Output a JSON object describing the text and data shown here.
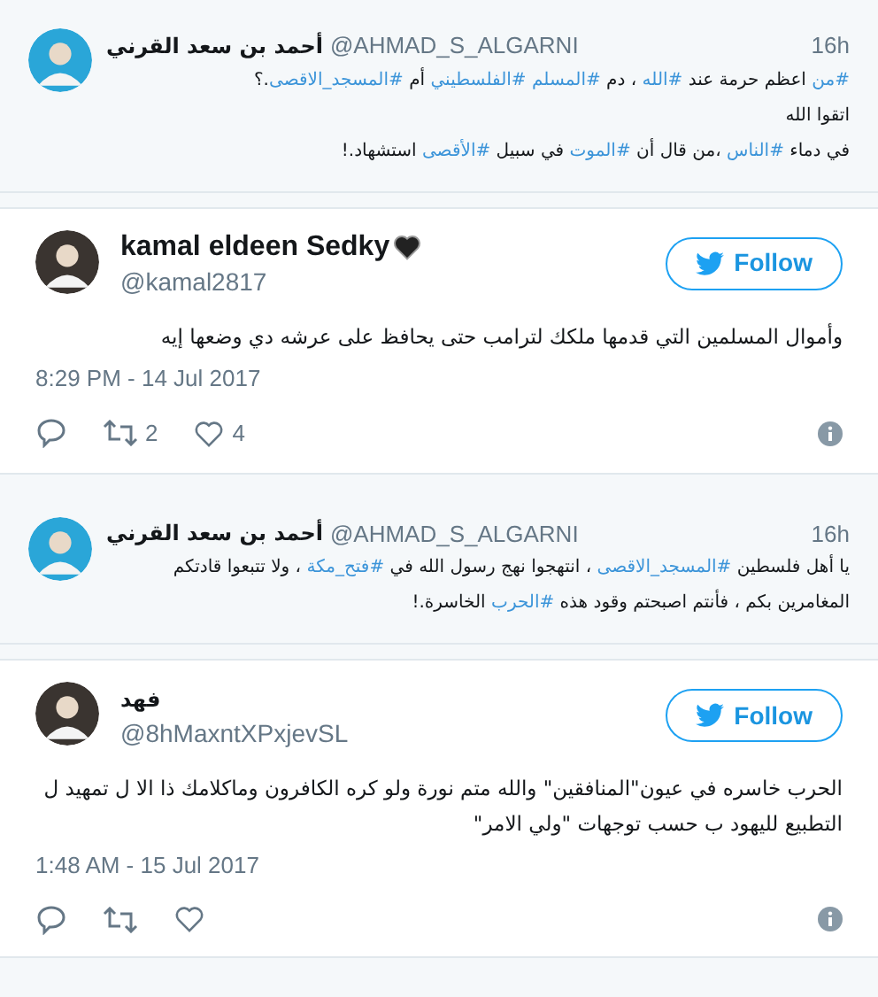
{
  "items": [
    {
      "kind": "quote",
      "name": "أحمد بن سعد القرني",
      "handle": "@AHMAD_S_ALGARNI",
      "time": "16h",
      "lines": [
        [
          {
            "text": "#من",
            "hashtag": true
          },
          {
            "text": " اعظم حرمة عند ",
            "hashtag": false
          },
          {
            "text": "#الله",
            "hashtag": true
          },
          {
            "text": " ، دم ",
            "hashtag": false
          },
          {
            "text": "#المسلم ",
            "hashtag": true
          },
          {
            "text": "#الفلسطيني",
            "hashtag": true
          },
          {
            "text": " أم ",
            "hashtag": false
          },
          {
            "text": "#المسجد_الاقصى",
            "hashtag": true
          },
          {
            "text": ".؟",
            "hashtag": false
          }
        ],
        [
          {
            "text": "اتقوا الله",
            "hashtag": false
          }
        ],
        [
          {
            "text": "في دماء ",
            "hashtag": false
          },
          {
            "text": "#الناس",
            "hashtag": true
          },
          {
            "text": " ،من قال أن ",
            "hashtag": false
          },
          {
            "text": "#الموت",
            "hashtag": true
          },
          {
            "text": " في سبيل ",
            "hashtag": false
          },
          {
            "text": "#الأقصى",
            "hashtag": true
          },
          {
            "text": " استشهاد.!",
            "hashtag": false
          }
        ]
      ]
    },
    {
      "kind": "tweet",
      "name": "kamal eldeen Sedky",
      "name_heart": true,
      "handle": "@kamal2817",
      "follow": "Follow",
      "text": "وأموال المسلمين التي قدمها ملكك لترامب حتى يحافظ على عرشه دي وضعها إيه",
      "date": "8:29 PM - 14 Jul 2017",
      "retweets": "2",
      "likes": "4"
    },
    {
      "kind": "quote",
      "name": "أحمد بن سعد القرني",
      "handle": "@AHMAD_S_ALGARNI",
      "time": "16h",
      "lines": [
        [
          {
            "text": "يا أهل فلسطين ",
            "hashtag": false
          },
          {
            "text": "#المسجد_الاقصى",
            "hashtag": true
          },
          {
            "text": " ، انتهجوا نهج رسول الله في ",
            "hashtag": false
          },
          {
            "text": "#فتح_مكة",
            "hashtag": true
          },
          {
            "text": " ، ولا تتبعوا قادتكم",
            "hashtag": false
          }
        ],
        [
          {
            "text": "المغامرين بكم ، فأنتم اصبحتم وقود هذه ",
            "hashtag": false
          },
          {
            "text": "#الحرب",
            "hashtag": true
          },
          {
            "text": " الخاسرة.!",
            "hashtag": false
          }
        ]
      ]
    },
    {
      "kind": "tweet",
      "name": "فهد",
      "name_heart": false,
      "handle": "@8hMaxntXPxjevSL",
      "follow": "Follow",
      "text": "الحرب خاسره في عيون\"المنافقين\" والله متم نورة ولو كره الكافرون وماكلامك ذا الا ل تمهيد ل التطبيع لليهود ب حسب توجهات \"ولي الامر\"",
      "date": "1:48 AM - 15 Jul 2017"
    }
  ]
}
